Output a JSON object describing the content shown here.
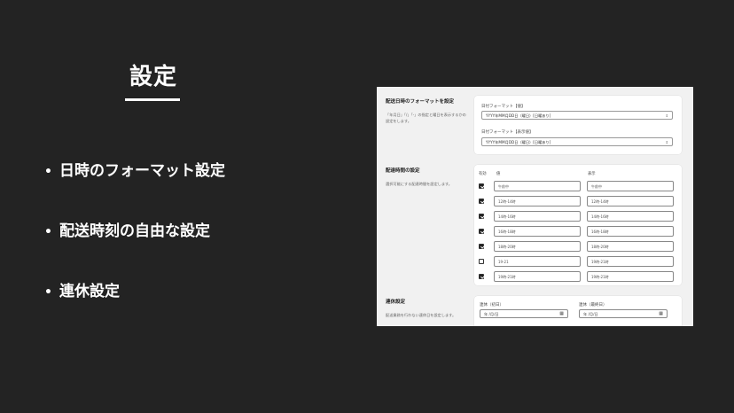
{
  "title": "設定",
  "bullets": [
    "日時のフォーマット設定",
    "配送時刻の自由な設定",
    "連休設定"
  ],
  "panel": {
    "date_format": {
      "title": "配送日時のフォーマットを設定",
      "desc": "「年月日」「/」「-」の指定と曜日を表示するかの設定をします。",
      "fields": [
        {
          "label": "日付フォーマット【値】",
          "value": "YYYY年MM月DD日（曜日）[日曜あり]"
        },
        {
          "label": "日付フォーマット【表示値】",
          "value": "YYYY年MM月DD日（曜日）[日曜あり]"
        }
      ]
    },
    "time_slots": {
      "title": "配達時間の設定",
      "desc": "選択可能にする配達時間を設定します。",
      "headers": {
        "enabled": "有効",
        "value": "値",
        "display": "表示"
      },
      "rows": [
        {
          "checked": true,
          "value": "午前中",
          "display": "午前中"
        },
        {
          "checked": true,
          "value": "12時-14時",
          "display": "12時-14時"
        },
        {
          "checked": true,
          "value": "14時-16時",
          "display": "14時-16時"
        },
        {
          "checked": true,
          "value": "16時-18時",
          "display": "16時-18時"
        },
        {
          "checked": true,
          "value": "18時-20時",
          "display": "18時-20時"
        },
        {
          "checked": false,
          "value": "19-21",
          "display": "19時-21時"
        },
        {
          "checked": true,
          "value": "19時-21時",
          "display": "19時-21時"
        }
      ]
    },
    "holiday": {
      "title": "連休設定",
      "desc": "配送業務を行わない連休日を設定します。",
      "start_label": "連休（初日）",
      "end_label": "連休（最終日）",
      "start_value": "年 /月/日",
      "end_value": "年 /月/日"
    }
  }
}
